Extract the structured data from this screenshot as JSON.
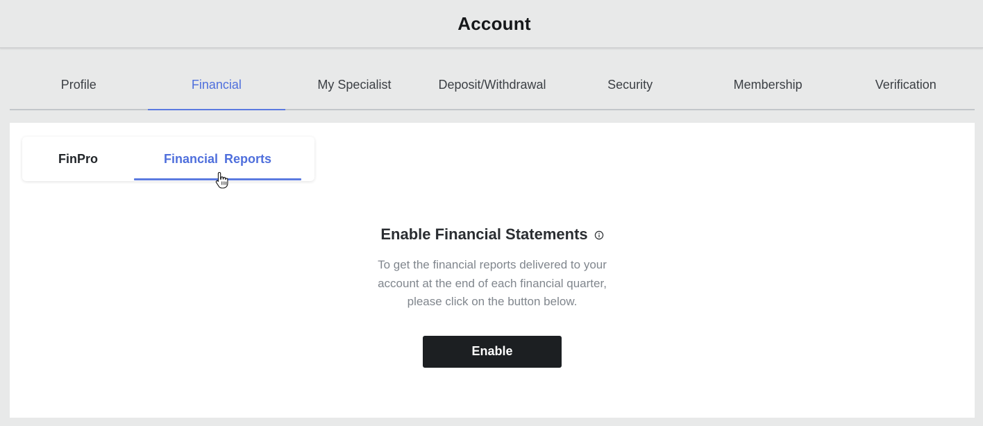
{
  "header": {
    "title": "Account"
  },
  "tabs": [
    {
      "label": "Profile"
    },
    {
      "label": "Financial"
    },
    {
      "label": "My Specialist"
    },
    {
      "label": "Deposit/Withdrawal"
    },
    {
      "label": "Security"
    },
    {
      "label": "Membership"
    },
    {
      "label": "Verification"
    }
  ],
  "active_tab": "Financial",
  "subtabs": [
    {
      "label": "FinPro"
    },
    {
      "label": "Financial Reports"
    }
  ],
  "active_subtab": "Financial Reports",
  "content": {
    "title": "Enable Financial Statements",
    "description_lines": [
      "To get the financial reports delivered to your",
      "account at the end of each financial quarter,",
      "please click on the button below."
    ],
    "button_label": "Enable"
  },
  "icons": {
    "info": "info-circle-icon",
    "cursor": "hand-pointer-icon"
  },
  "colors": {
    "accent": "#5b7ae0",
    "button": "#1c1f22",
    "background": "#e8e9e9"
  }
}
